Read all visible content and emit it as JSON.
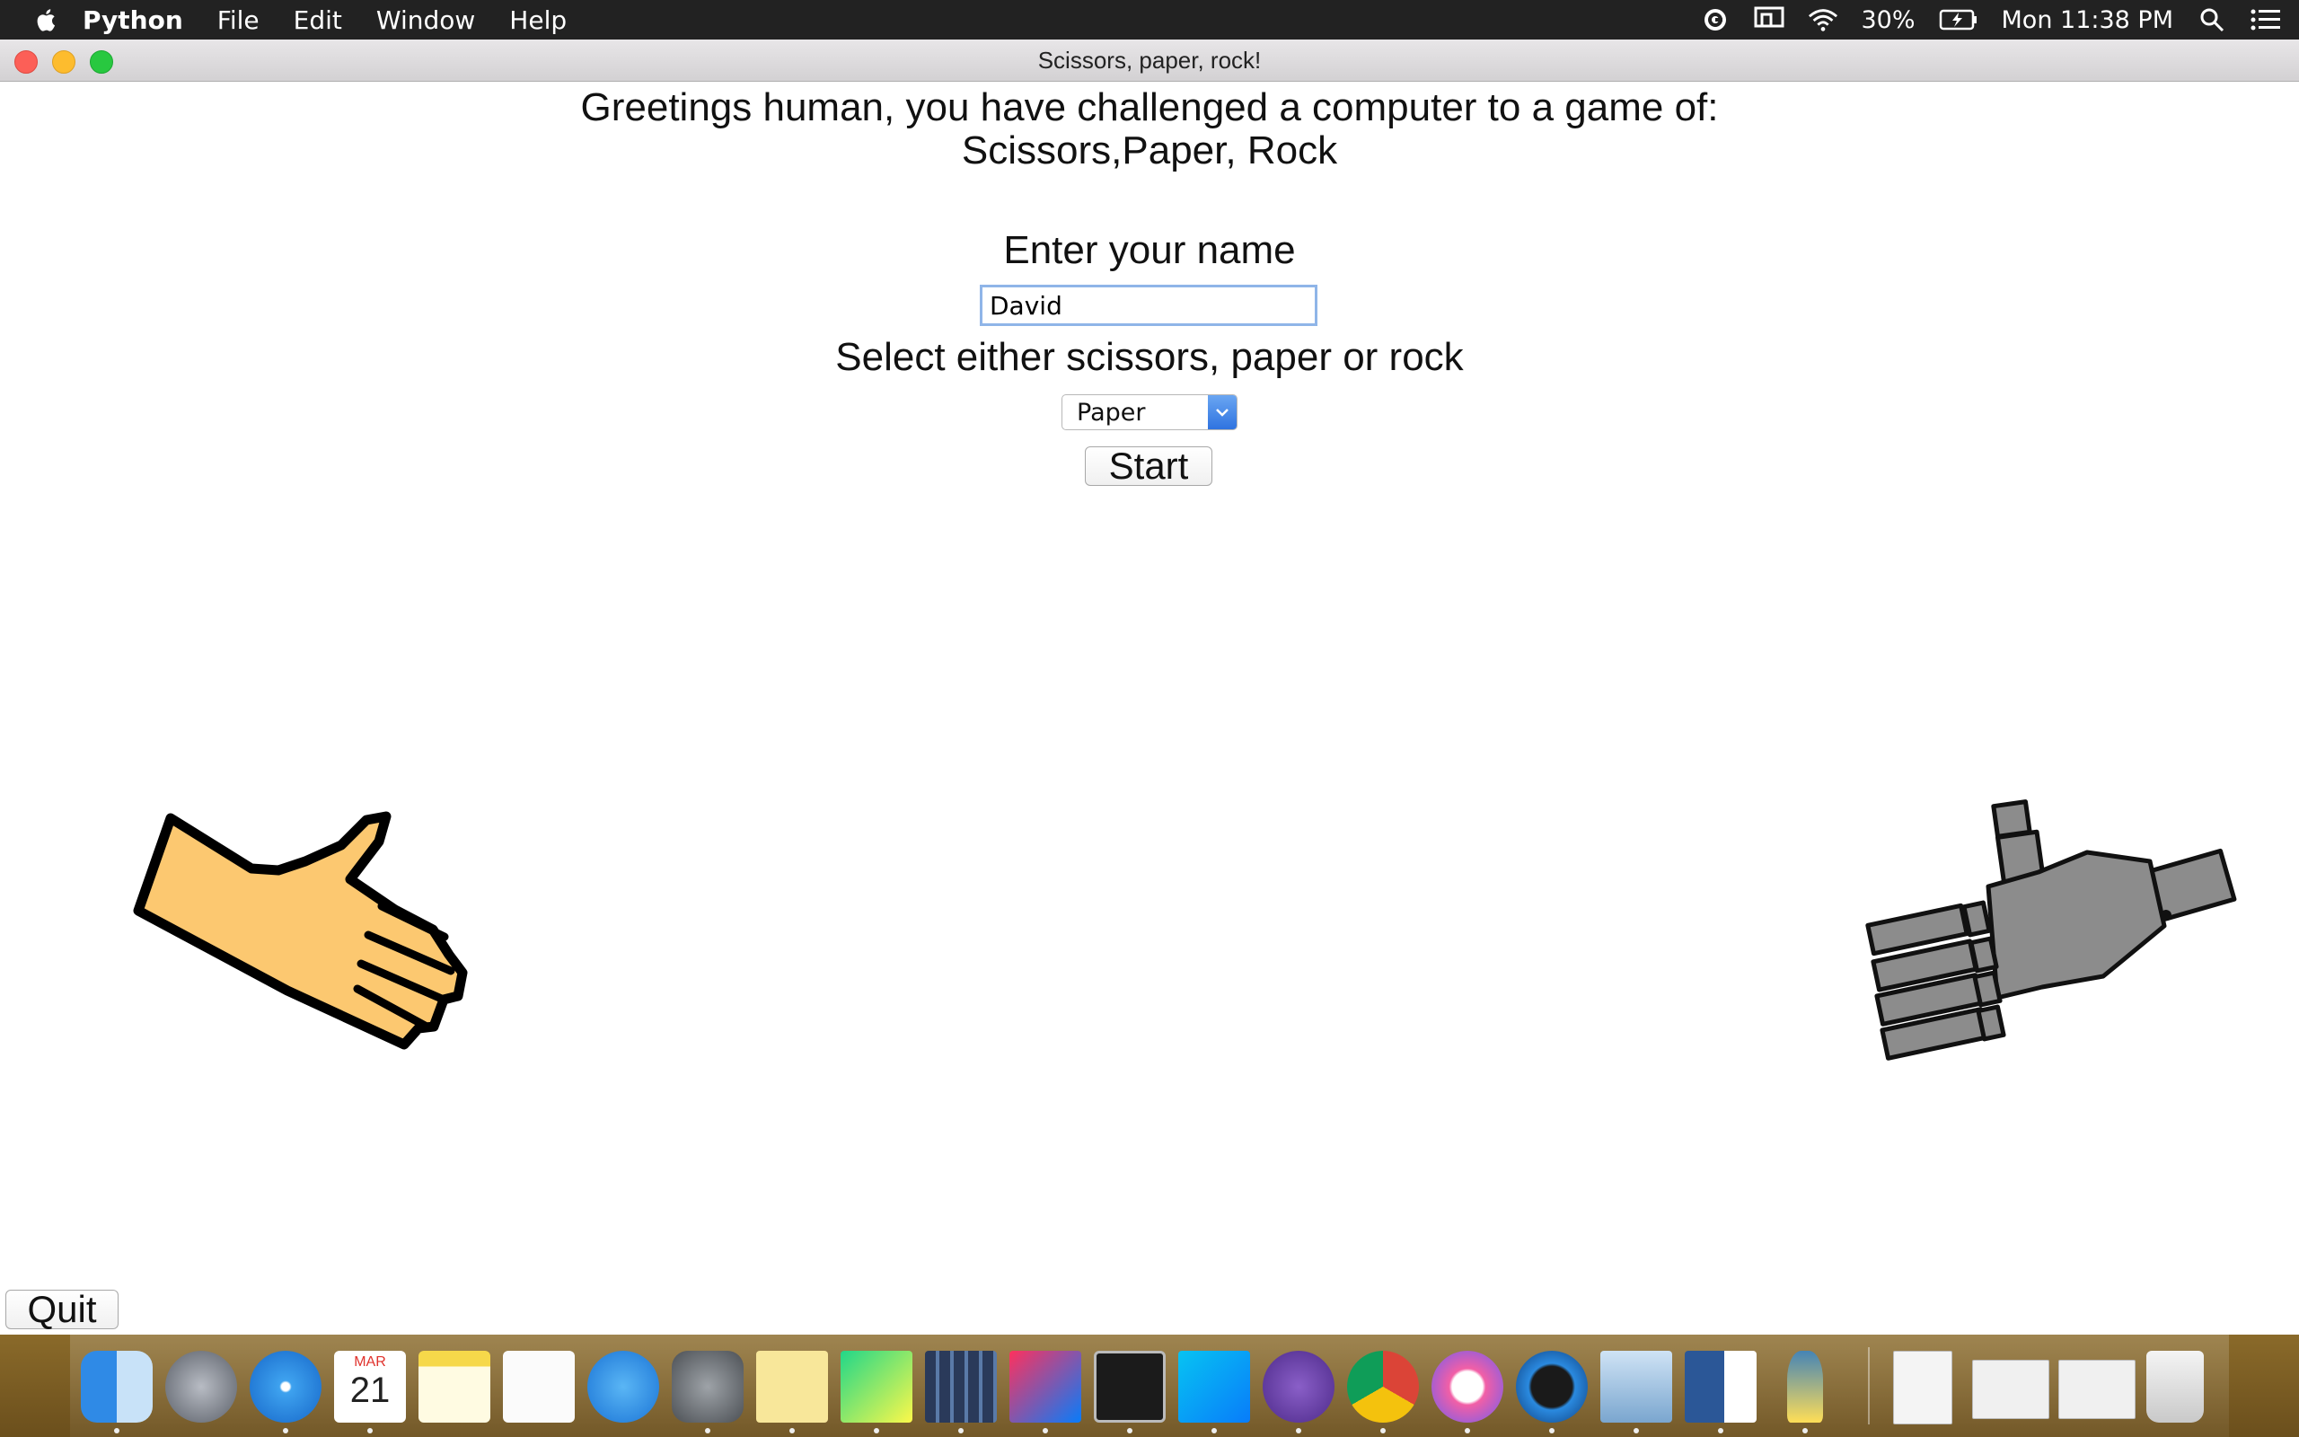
{
  "menubar": {
    "app_name": "Python",
    "items": [
      "File",
      "Edit",
      "Window",
      "Help"
    ],
    "battery": "30%",
    "clock": "Mon 11:38 PM"
  },
  "window": {
    "title": "Scissors, paper, rock!"
  },
  "main": {
    "greeting_line1": "Greetings human, you have challenged a computer to a game of:",
    "greeting_line2": "Scissors,Paper, Rock",
    "name_label": "Enter your name",
    "name_value": "David",
    "select_label": "Select either scissors, paper or rock",
    "selected_choice": "Paper",
    "start_label": "Start",
    "quit_label": "Quit"
  },
  "dock": {
    "apps": [
      "finder",
      "launchpad",
      "safari",
      "calendar",
      "notes",
      "reminders",
      "app-store",
      "system-preferences",
      "stickies",
      "pycharm",
      "books-shelf",
      "intellij",
      "terminal",
      "webstorm",
      "github-desktop",
      "chrome",
      "itunes",
      "quicktime",
      "preview",
      "word",
      "python-launcher",
      "document",
      "chrome-doc-1",
      "chrome-doc-2",
      "trash"
    ],
    "calendar_month": "MAR",
    "calendar_day": "21"
  },
  "colors": {
    "menubar_bg": "#222222",
    "hand_skin": "#fcc870",
    "robot_gray": "#8c8c8c",
    "select_arrow": "#2f73e0"
  }
}
